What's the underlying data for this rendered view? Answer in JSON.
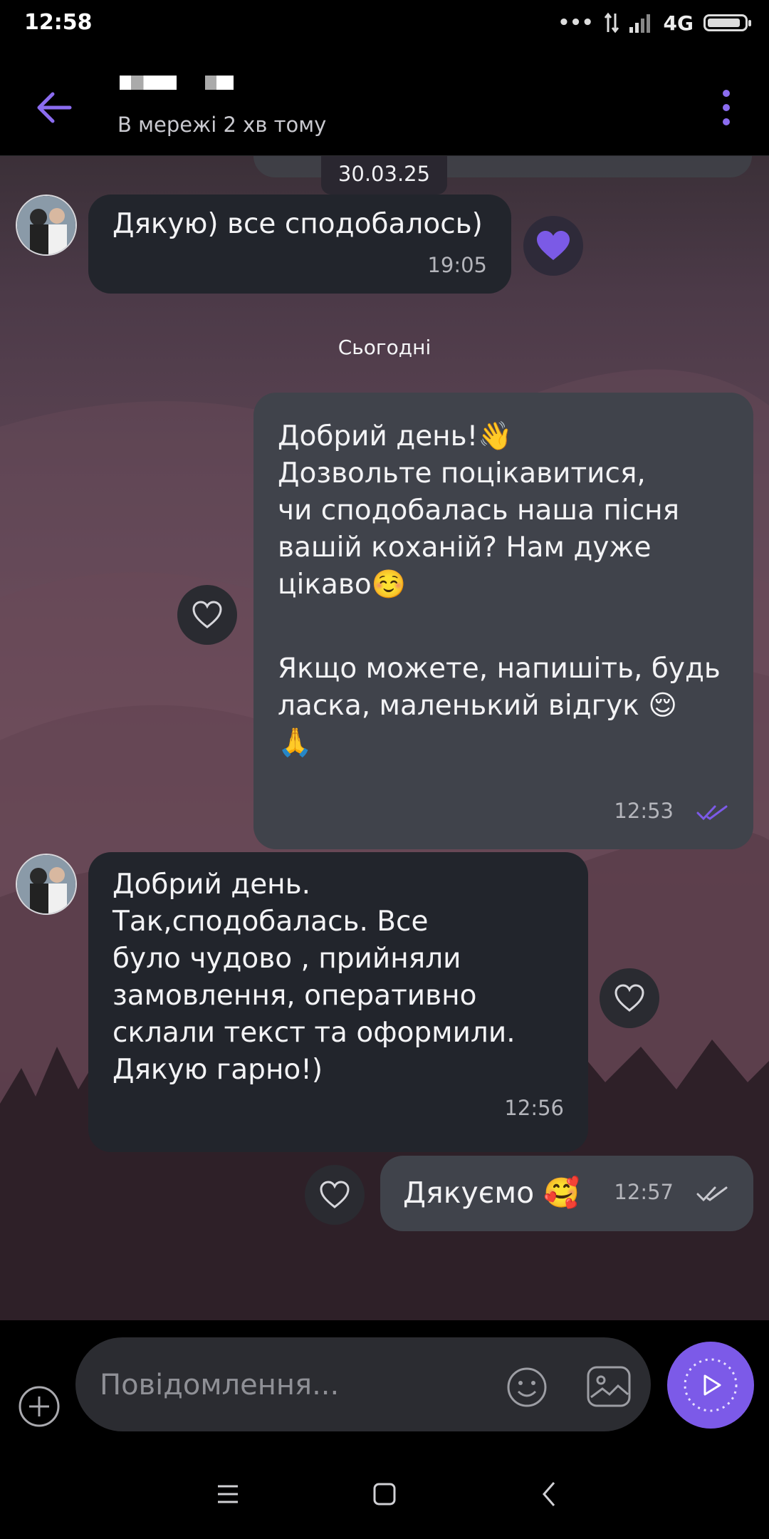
{
  "status_bar": {
    "time": "12:58",
    "more_glyph": "•••",
    "network": "4G",
    "battery_level": 0.9
  },
  "header": {
    "back_icon": "arrow-left-icon",
    "contact_status": "В мережі 2 хв тому",
    "menu_icon": "more-vertical-icon",
    "accent_color": "#8b6cf0"
  },
  "chat": {
    "date_chip": "30.03.25",
    "day_label": "Сьогодні",
    "messages": [
      {
        "direction": "incoming",
        "text": "Дякую) все сподобалось)",
        "time": "19:05",
        "reaction": "purple-heart"
      },
      {
        "direction": "outgoing",
        "text_1": "Добрий день!👋\nДозвольте поцікавитися,\nчи сподобалась наша пісня\nвашій коханій? Нам дуже\nцікаво☺️",
        "text_2": "Якщо можете, напишіть, будь\nласка, маленький відгук 😌\n🙏",
        "time": "12:53",
        "status": "read"
      },
      {
        "direction": "incoming",
        "text": "Добрий день.\nТак,сподобалась.  Все\nбуло чудово , прийняли\nзамовлення, оперативно\nсклали текст та оформили.\nДякую гарно!)",
        "time": "12:56"
      },
      {
        "direction": "outgoing",
        "text": "Дякуємо 🥰",
        "time": "12:57",
        "status": "delivered"
      }
    ]
  },
  "composer": {
    "placeholder": "Повідомлення...",
    "add_icon": "plus-circle-icon",
    "emoji_icon": "smiley-icon",
    "gallery_icon": "image-icon",
    "send_icon": "play-icon",
    "send_color": "#7c5ae8"
  },
  "nav_bar": {
    "menu_icon": "menu-icon",
    "home_icon": "home-square-icon",
    "back_icon": "back-chevron-icon"
  }
}
